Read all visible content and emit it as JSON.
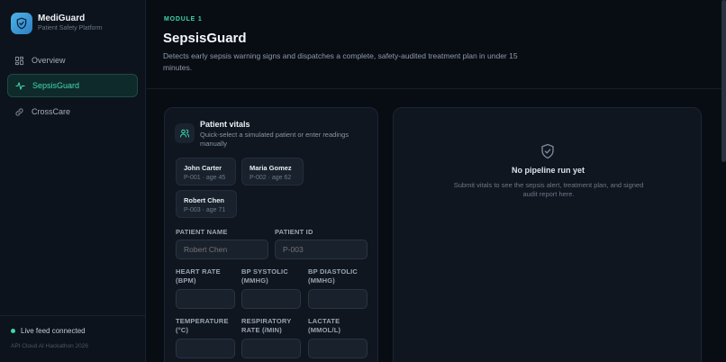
{
  "brand": {
    "name": "MediGuard",
    "subtitle": "Patient Safety Platform"
  },
  "nav": [
    {
      "label": "Overview",
      "icon": "grid-icon",
      "active": false
    },
    {
      "label": "SepsisGuard",
      "icon": "pulse-icon",
      "active": true
    },
    {
      "label": "CrossCare",
      "icon": "link-icon",
      "active": false
    }
  ],
  "sidebar_footer": {
    "status": "Live feed connected",
    "credit": "API Cloud AI Hackathon 2026"
  },
  "header": {
    "module": "MODULE 1",
    "title": "SepsisGuard",
    "description": "Detects early sepsis warning signs and dispatches a complete, safety-audited treatment plan in under 15 minutes."
  },
  "vitals": {
    "title": "Patient vitals",
    "subtitle": "Quick-select a simulated patient or enter readings manually",
    "patients": [
      {
        "name": "John Carter",
        "meta": "P-001 · age 45"
      },
      {
        "name": "Maria Gomez",
        "meta": "P-002 · age 62"
      },
      {
        "name": "Robert Chen",
        "meta": "P-003 · age 71"
      }
    ],
    "fields": {
      "patient_name": {
        "label": "PATIENT NAME",
        "placeholder": "Robert Chen"
      },
      "patient_id": {
        "label": "PATIENT ID",
        "placeholder": "P-003"
      },
      "heart_rate": {
        "label": "HEART RATE (BPM)",
        "placeholder": ""
      },
      "bp_systolic": {
        "label": "BP SYSTOLIC (MMHG)",
        "placeholder": ""
      },
      "bp_diastolic": {
        "label": "BP DIASTOLIC (MMHG)",
        "placeholder": ""
      },
      "temperature": {
        "label": "TEMPERATURE (°C)",
        "placeholder": ""
      },
      "respiratory_rate": {
        "label": "RESPIRATORY RATE (/MIN)",
        "placeholder": ""
      },
      "lactate": {
        "label": "LACTATE (MMOL/L)",
        "placeholder": ""
      }
    }
  },
  "pipeline": {
    "empty_title": "No pipeline run yet",
    "empty_desc": "Submit vitals to see the sepsis alert, treatment plan, and signed audit report here."
  },
  "colors": {
    "accent": "#3fd7a8",
    "background": "#080d14",
    "sidebar": "#0d131c",
    "card": "#0f1620"
  }
}
